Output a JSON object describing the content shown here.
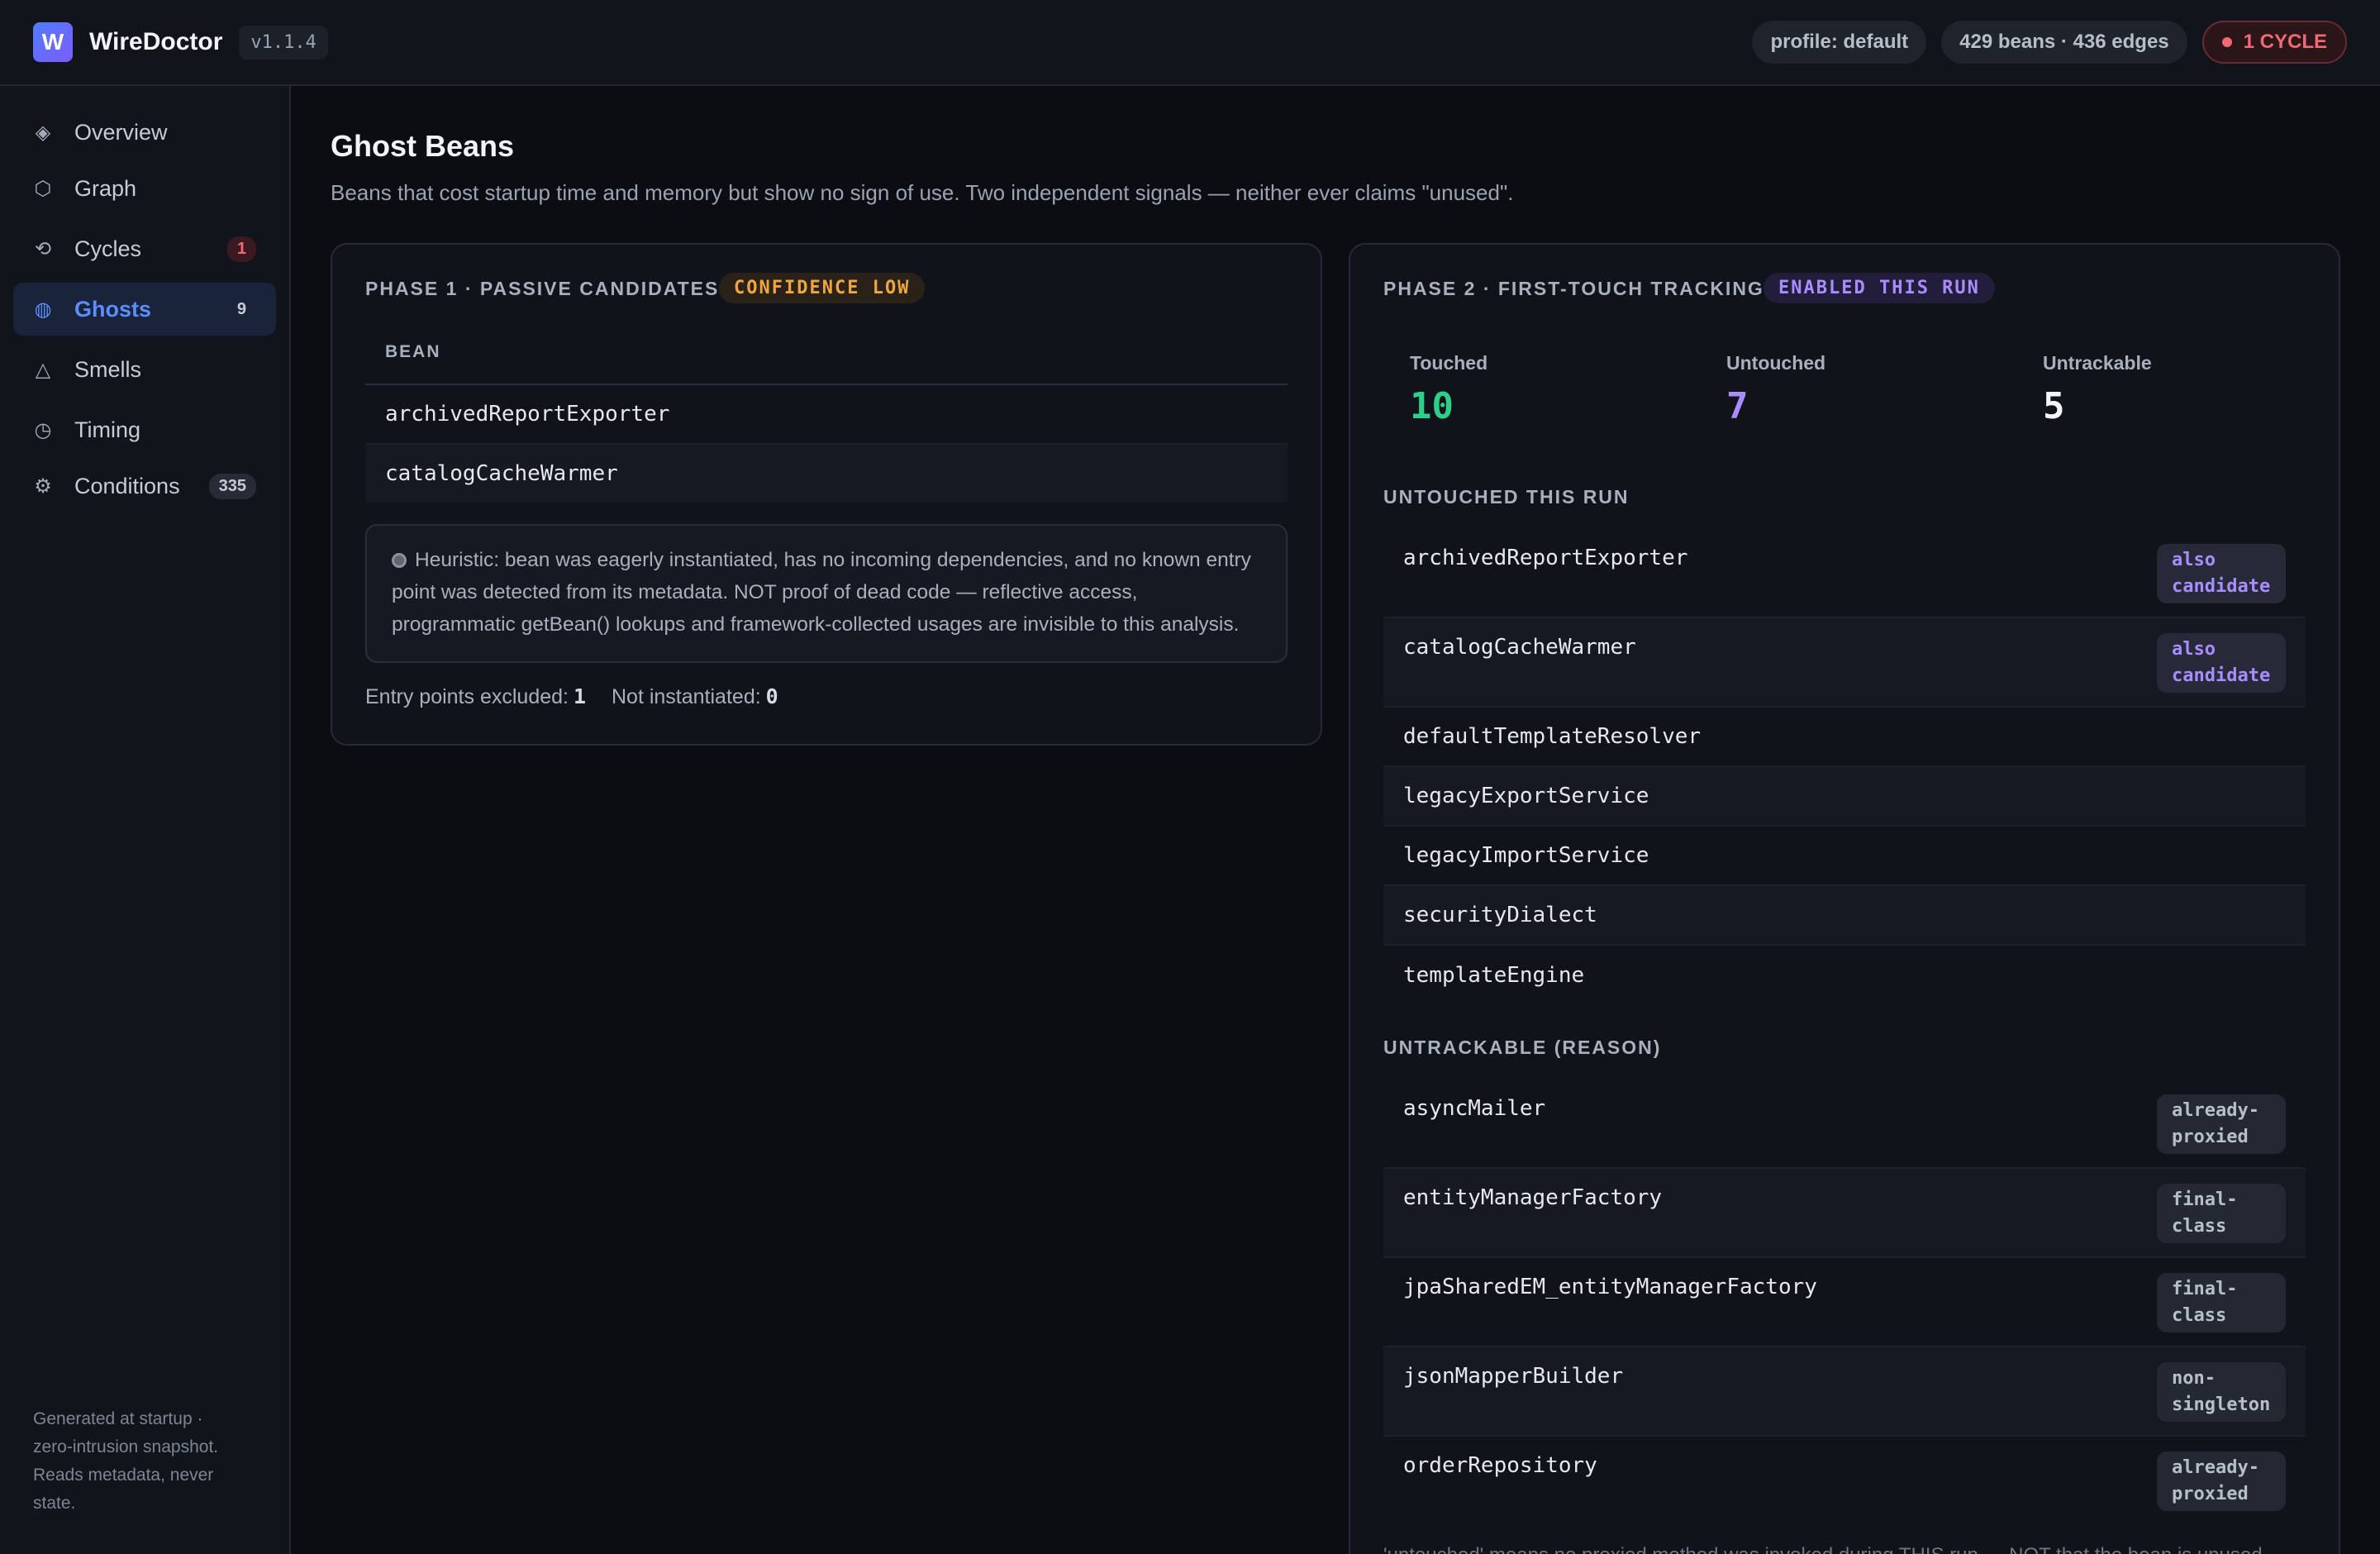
{
  "app": {
    "logo_letter": "W",
    "name": "WireDoctor",
    "version": "v1.1.4"
  },
  "header": {
    "profile": "profile: default",
    "counts": "429 beans · 436 edges",
    "cycle_alert": "1 CYCLE"
  },
  "sidebar": {
    "items": [
      {
        "label": "Overview",
        "icon": "diamond-icon",
        "glyph": "◈",
        "count": null
      },
      {
        "label": "Graph",
        "icon": "hexagon-icon",
        "glyph": "⬡",
        "count": null
      },
      {
        "label": "Cycles",
        "icon": "cycle-icon",
        "glyph": "⟲",
        "count": "1"
      },
      {
        "label": "Ghosts",
        "icon": "ghost-icon",
        "glyph": "◍",
        "count": "9"
      },
      {
        "label": "Smells",
        "icon": "triangle-icon",
        "glyph": "△",
        "count": null
      },
      {
        "label": "Timing",
        "icon": "clock-icon",
        "glyph": "◷",
        "count": null
      },
      {
        "label": "Conditions",
        "icon": "gear-icon",
        "glyph": "⚙",
        "count": "335"
      }
    ],
    "footer": "Generated at startup · zero-intrusion snapshot. Reads metadata, never state."
  },
  "page": {
    "title": "Ghost Beans",
    "subtitle": "Beans that cost startup time and memory but show no sign of use. Two independent signals — neither ever claims \"unused\"."
  },
  "phase1": {
    "title": "PHASE 1 · PASSIVE CANDIDATES",
    "badge": "CONFIDENCE LOW",
    "column": "BEAN",
    "beans": [
      "archivedReportExporter",
      "catalogCacheWarmer"
    ],
    "note": "Heuristic: bean was eagerly instantiated, has no incoming dependencies, and no known entry point was detected from its metadata. NOT proof of dead code — reflective access, programmatic getBean() lookups and framework-collected usages are invisible to this analysis.",
    "entry_label": "Entry points excluded:",
    "entry_value": "1",
    "notinst_label": "Not instantiated:",
    "notinst_value": "0"
  },
  "phase2": {
    "title": "PHASE 2 · FIRST-TOUCH TRACKING",
    "badge": "ENABLED THIS RUN",
    "stats": {
      "touched_label": "Touched",
      "touched": "10",
      "untouched_label": "Untouched",
      "untouched": "7",
      "untrackable_label": "Untrackable",
      "untrackable": "5"
    },
    "untouched_title": "UNTOUCHED THIS RUN",
    "untouched": [
      {
        "name": "archivedReportExporter",
        "tag": "also candidate"
      },
      {
        "name": "catalogCacheWarmer",
        "tag": "also candidate"
      },
      {
        "name": "defaultTemplateResolver",
        "tag": null
      },
      {
        "name": "legacyExportService",
        "tag": null
      },
      {
        "name": "legacyImportService",
        "tag": null
      },
      {
        "name": "securityDialect",
        "tag": null
      },
      {
        "name": "templateEngine",
        "tag": null
      }
    ],
    "untrackable_title": "UNTRACKABLE (REASON)",
    "untrackable": [
      {
        "name": "asyncMailer",
        "reason": "already-proxied"
      },
      {
        "name": "entityManagerFactory",
        "reason": "final-class"
      },
      {
        "name": "jpaSharedEM_entityManagerFactory",
        "reason": "final-class"
      },
      {
        "name": "jsonMapperBuilder",
        "reason": "non-singleton"
      },
      {
        "name": "orderRepository",
        "reason": "already-proxied"
      }
    ],
    "footnote": "'untouched' means no proxied method was invoked during THIS run — NOT that the bean is unused."
  }
}
